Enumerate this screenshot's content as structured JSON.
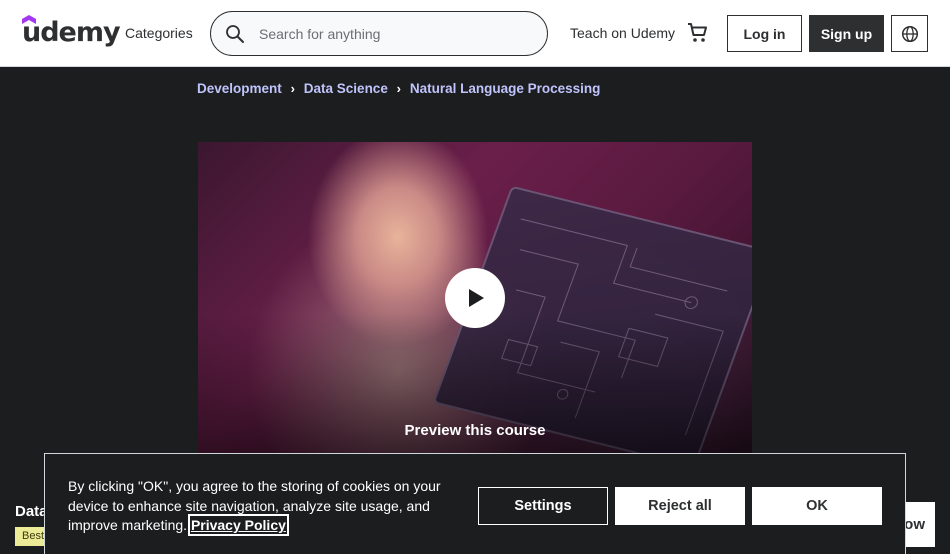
{
  "header": {
    "logo_text": "udemy",
    "categories_label": "Categories",
    "search_placeholder": "Search for anything",
    "teach_label": "Teach on Udemy",
    "login_label": "Log in",
    "signup_label": "Sign up"
  },
  "breadcrumb": {
    "items": [
      "Development",
      "Data Science",
      "Natural Language Processing"
    ]
  },
  "preview": {
    "label": "Preview this course"
  },
  "sticky_bar": {
    "title_fragment": "Data",
    "badge_fragment": "Bestseller",
    "buy_fragment": "ow"
  },
  "cookie_banner": {
    "text": "By clicking \"OK\", you agree to the storing of cookies on your device to enhance site navigation, analyze site usage, and improve marketing. ",
    "link_label": "Privacy Policy",
    "settings_label": "Settings",
    "reject_label": "Reject all",
    "ok_label": "OK"
  },
  "colors": {
    "brand_purple": "#a435f0",
    "dark": "#2d2f31",
    "breadcrumb_link": "#c0c4fc",
    "bestseller_badge": "#eceb98"
  },
  "icons": [
    "search-icon",
    "cart-icon",
    "globe-icon",
    "play-icon",
    "chevron-right-icon"
  ]
}
